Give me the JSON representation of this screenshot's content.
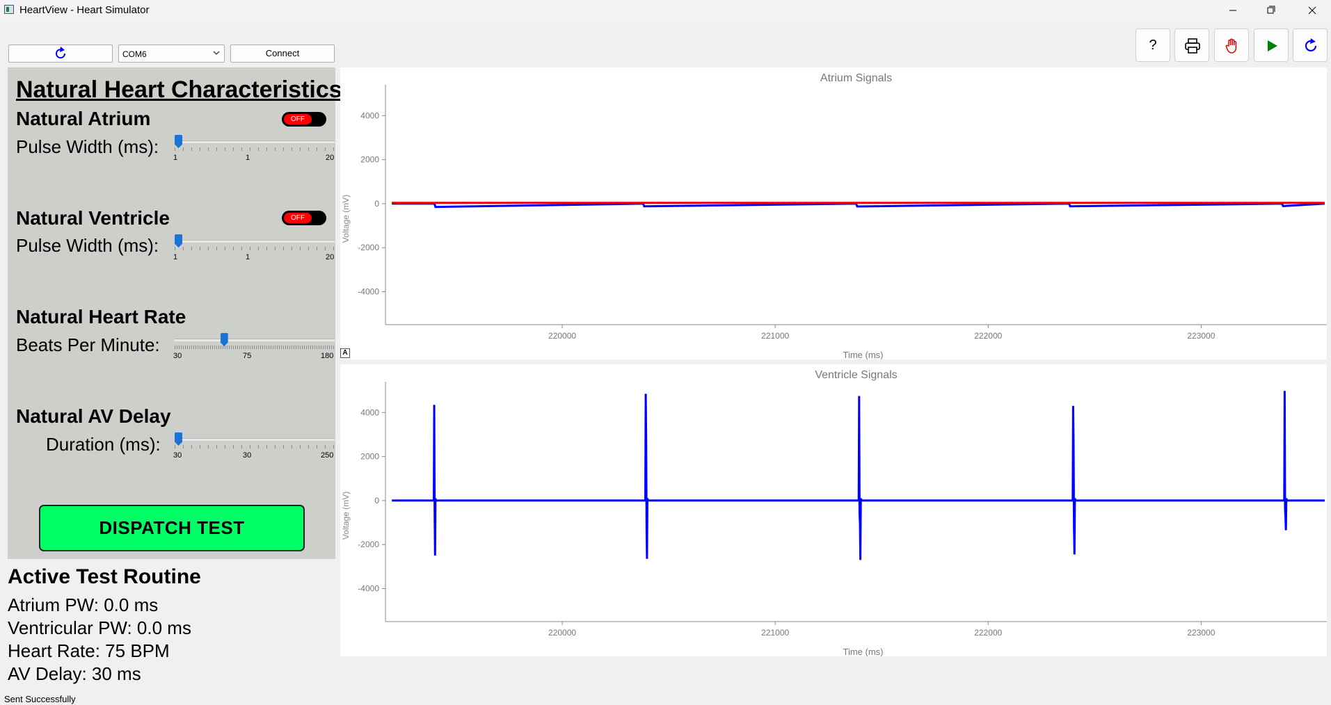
{
  "window": {
    "title": "HeartView - Heart Simulator"
  },
  "connection": {
    "port": "COM6",
    "connect_label": "Connect"
  },
  "toolbar": {
    "help_label": "?"
  },
  "panel": {
    "title": "Natural Heart Characteristics",
    "atrium": {
      "title": "Natural Atrium",
      "toggle": "OFF",
      "label": "Pulse Width (ms):",
      "min": "1",
      "current": "1",
      "max": "20",
      "value": 1,
      "range": [
        1,
        20
      ]
    },
    "ventricle": {
      "title": "Natural Ventricle",
      "toggle": "OFF",
      "label": "Pulse Width (ms):",
      "min": "1",
      "current": "1",
      "max": "20",
      "value": 1,
      "range": [
        1,
        20
      ]
    },
    "heart_rate": {
      "title": "Natural Heart Rate",
      "label": "Beats Per Minute:",
      "min": "30",
      "current": "75",
      "max": "180",
      "value": 75,
      "range": [
        30,
        180
      ]
    },
    "av_delay": {
      "title": "Natural AV Delay",
      "label": "Duration (ms):",
      "min": "30",
      "current": "30",
      "max": "250",
      "value": 30,
      "range": [
        30,
        250
      ]
    },
    "dispatch_label": "DISPATCH TEST"
  },
  "active": {
    "title": "Active Test Routine",
    "atrium_pw": "Atrium PW: 0.0 ms",
    "ventricular_pw": "Ventricular PW: 0.0 ms",
    "heart_rate": "Heart Rate: 75 BPM",
    "av_delay": "AV Delay: 30 ms"
  },
  "status_bar": {
    "message": "Sent Successfully"
  },
  "colors": {
    "signal_blue": "#0000ff",
    "signal_red": "#e8000b",
    "dispatch_green": "#00ff66",
    "toggle_red": "#ff0000"
  },
  "chart_data": [
    {
      "type": "line",
      "title": "Atrium Signals",
      "xlabel": "Time (ms)",
      "ylabel": "Voltage (mV)",
      "xlim": [
        219170,
        223590
      ],
      "ylim": [
        -5500,
        5400
      ],
      "x_ticks": [
        "220000",
        "221000",
        "222000",
        "223000"
      ],
      "y_ticks": [
        "4000",
        "2000",
        "0",
        "-2000",
        "-4000"
      ],
      "series": [
        {
          "color": "#0000ff",
          "x": [
            219200,
            219400,
            219405,
            220380,
            220385,
            221380,
            221385,
            222380,
            222385,
            223380,
            223385,
            223580
          ],
          "y": [
            0,
            0,
            -150,
            0,
            -120,
            0,
            -130,
            0,
            -120,
            0,
            -110,
            0
          ]
        },
        {
          "color": "#e8000b",
          "x": [
            219200,
            223580
          ],
          "y": [
            40,
            40
          ]
        }
      ]
    },
    {
      "type": "line",
      "title": "Ventricle Signals",
      "xlabel": "Time (ms)",
      "ylabel": "Voltage (mV)",
      "xlim": [
        219170,
        223590
      ],
      "ylim": [
        -5500,
        5400
      ],
      "x_ticks": [
        "220000",
        "221000",
        "222000",
        "223000"
      ],
      "y_ticks": [
        "4000",
        "2000",
        "0",
        "-2000",
        "-4000"
      ],
      "series": [
        {
          "color": "#0000ff",
          "x": [
            219200,
            219397,
            219399,
            219401,
            219403,
            219405,
            219407,
            219410,
            220390,
            220392,
            220394,
            220396,
            220398,
            220400,
            220403,
            221392,
            221394,
            221396,
            221398,
            221400,
            221402,
            221405,
            222397,
            222399,
            222401,
            222403,
            222405,
            222407,
            222410,
            223390,
            223392,
            223394,
            223396,
            223398,
            223400,
            223403,
            223580
          ],
          "y": [
            0,
            0,
            4350,
            -500,
            -2500,
            100,
            0,
            0,
            0,
            4850,
            2700,
            -1200,
            -2650,
            100,
            0,
            0,
            4750,
            -600,
            -1000,
            -2700,
            100,
            0,
            0,
            4300,
            2600,
            -1200,
            -2450,
            100,
            0,
            0,
            4980,
            -400,
            -800,
            -1350,
            100,
            0,
            0
          ]
        }
      ]
    }
  ]
}
